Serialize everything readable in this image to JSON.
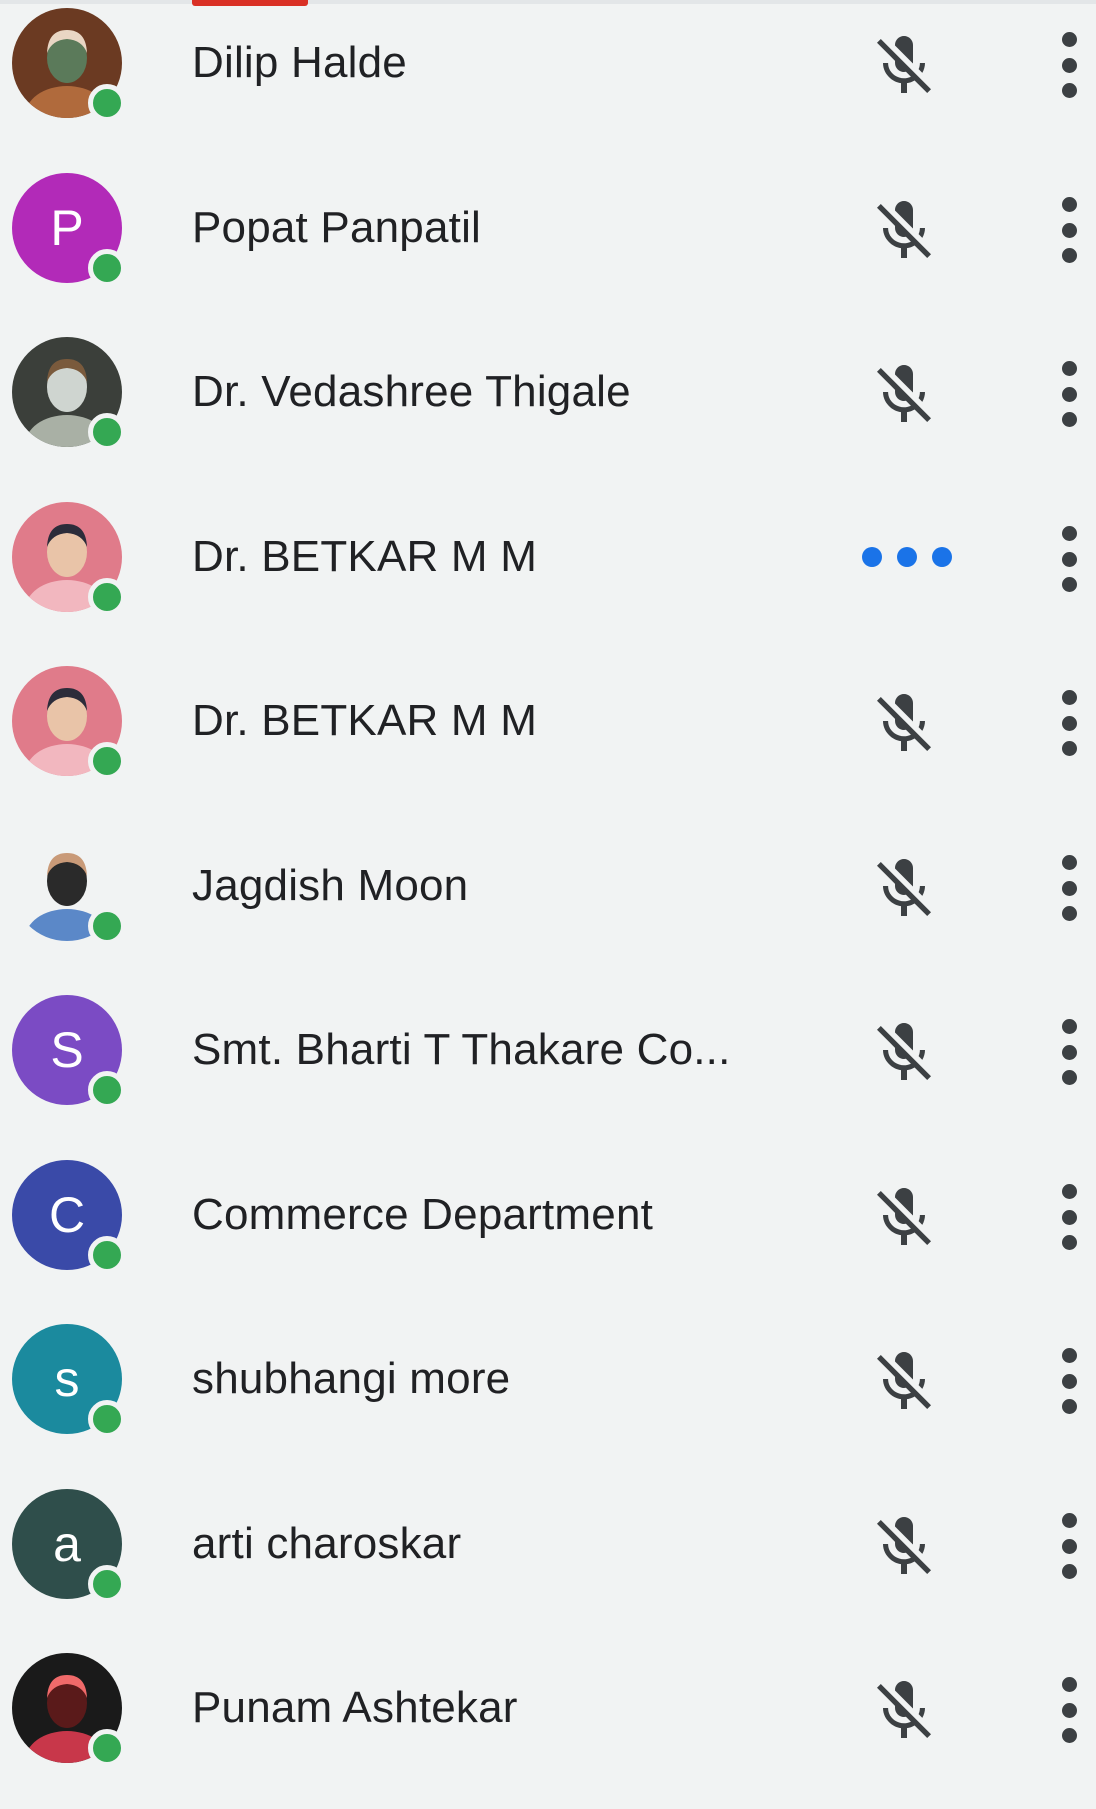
{
  "participants": [
    {
      "name": "Dilip Halde",
      "avatar": {
        "type": "photo",
        "colors": [
          "#6b3a22",
          "#b06a3c",
          "#e9d6c4",
          "#5b7a5a"
        ]
      },
      "status": "muted"
    },
    {
      "name": "Popat Panpatil",
      "avatar": {
        "type": "initial",
        "letter": "P",
        "color": "#b22ab8"
      },
      "status": "muted"
    },
    {
      "name": "Dr. Vedashree Thigale",
      "avatar": {
        "type": "photo",
        "colors": [
          "#3b3f3a",
          "#a9b0a5",
          "#7a5a3c",
          "#cfd5d0"
        ]
      },
      "status": "muted"
    },
    {
      "name": "Dr. BETKAR M M",
      "avatar": {
        "type": "photo",
        "colors": [
          "#e07b8a",
          "#f2b7bf",
          "#2c2c3a",
          "#e9c4a8"
        ]
      },
      "status": "speaking"
    },
    {
      "name": "Dr. BETKAR M M",
      "avatar": {
        "type": "photo",
        "colors": [
          "#e07b8a",
          "#f2b7bf",
          "#2c2c3a",
          "#e9c4a8"
        ]
      },
      "status": "muted"
    },
    {
      "name": "Jagdish Moon",
      "avatar": {
        "type": "photo",
        "colors": [
          "#f1f3f3",
          "#5b88c8",
          "#c99a78",
          "#2a2a2a"
        ]
      },
      "status": "muted"
    },
    {
      "name": "Smt. Bharti T Thakare Co...",
      "avatar": {
        "type": "initial",
        "letter": "S",
        "color": "#7b4bc4"
      },
      "status": "muted"
    },
    {
      "name": "Commerce Department",
      "avatar": {
        "type": "initial",
        "letter": "C",
        "color": "#3a4aa8"
      },
      "status": "muted"
    },
    {
      "name": "shubhangi more",
      "avatar": {
        "type": "initial",
        "letter": "s",
        "color": "#1b8a9e"
      },
      "status": "muted"
    },
    {
      "name": "arti charoskar",
      "avatar": {
        "type": "initial",
        "letter": "a",
        "color": "#2f4e4b"
      },
      "status": "muted"
    },
    {
      "name": "Punam Ashtekar",
      "avatar": {
        "type": "photo",
        "colors": [
          "#1a1a1a",
          "#c8374a",
          "#f06a6a",
          "#5a1a1a"
        ]
      },
      "status": "muted"
    }
  ],
  "icons": {
    "muted": "mic-off-icon",
    "speaking": "audio-level-icon",
    "more": "more-vert-icon"
  },
  "colors": {
    "presence": "#34a853",
    "speaking": "#1a73e8",
    "active_tab": "#d93025"
  }
}
